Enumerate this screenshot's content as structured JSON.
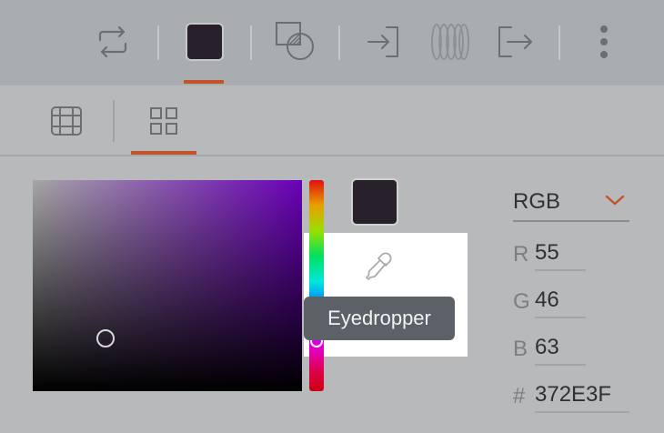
{
  "toolbar": {
    "items": [
      {
        "name": "swap-icon"
      },
      {
        "name": "current-color-swatch",
        "color": "#28202B"
      },
      {
        "name": "shape-overlap-icon"
      },
      {
        "name": "import-icon"
      },
      {
        "name": "rings-icon"
      },
      {
        "name": "export-icon"
      },
      {
        "name": "more-vertical-icon"
      }
    ],
    "accent_color": "#C4532A"
  },
  "tabs": [
    {
      "name": "grid-table-icon",
      "active": false
    },
    {
      "name": "grid-squares-icon",
      "active": true
    }
  ],
  "picker": {
    "hue_color": "#6A00B8",
    "selected_color": "#372E3F",
    "eyedropper_tooltip": "Eyedropper"
  },
  "mode": {
    "selected": "RGB"
  },
  "fields": {
    "r_label": "R",
    "r_value": "55",
    "g_label": "G",
    "g_value": "46",
    "b_label": "B",
    "b_value": "63",
    "hex_label": "#",
    "hex_value": "372E3F"
  }
}
